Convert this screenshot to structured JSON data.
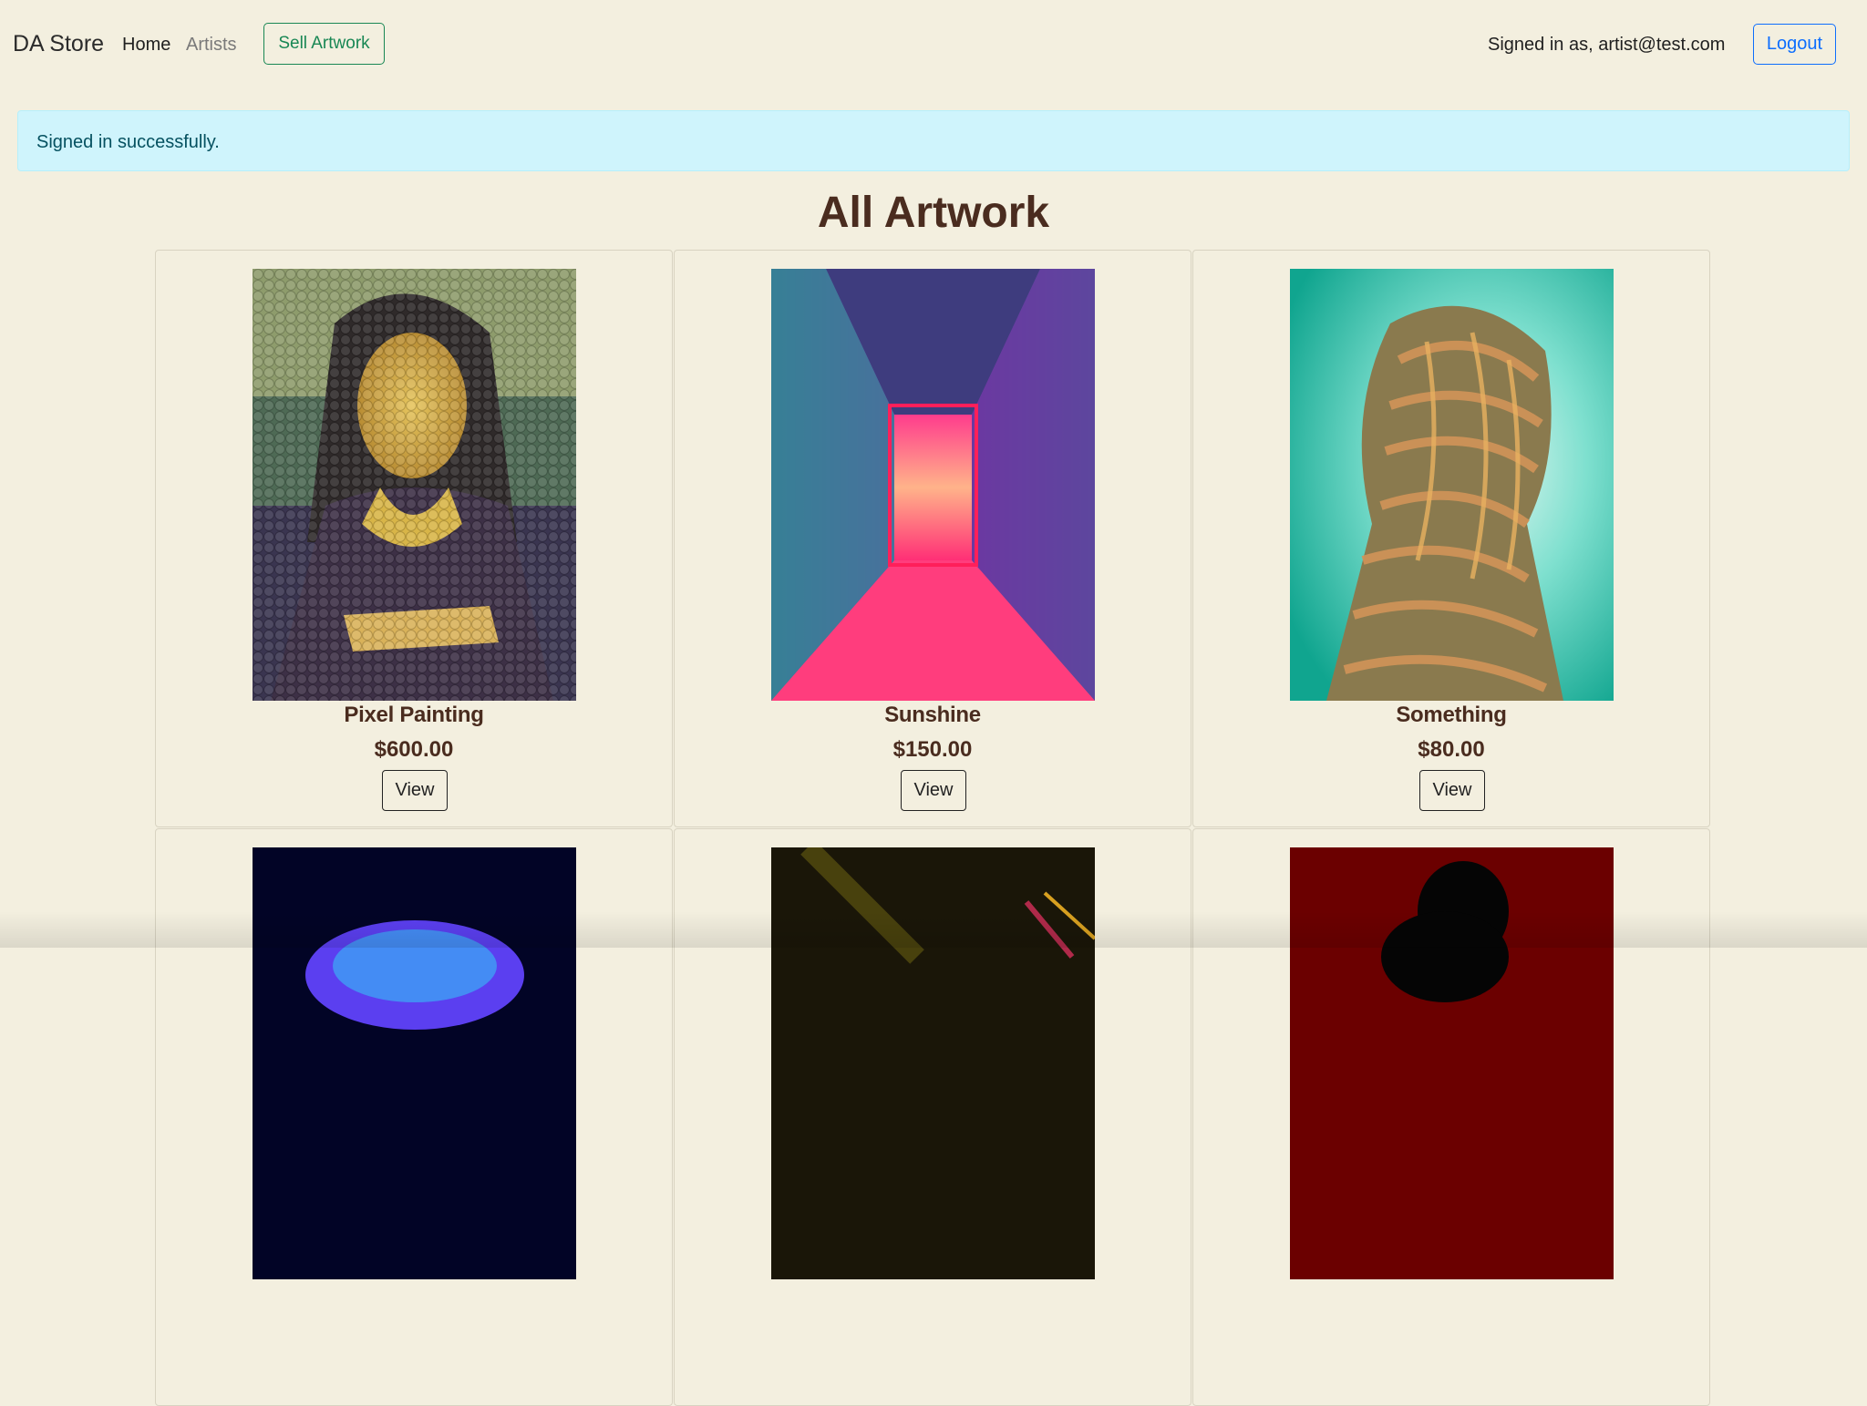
{
  "navbar": {
    "brand": "DA Store",
    "links": [
      "Home",
      "Artists"
    ],
    "sell_label": "Sell Artwork",
    "signed_in_text": "Signed in as, artist@test.com",
    "logout_label": "Logout"
  },
  "alert": {
    "message": "Signed in successfully."
  },
  "page": {
    "title": "All Artwork"
  },
  "artworks": [
    {
      "title": "Pixel Painting",
      "price": "$600.00",
      "view_label": "View",
      "image": "mona-lisa-pixel"
    },
    {
      "title": "Sunshine",
      "price": "$150.00",
      "view_label": "View",
      "image": "neon-corridor"
    },
    {
      "title": "Something",
      "price": "$80.00",
      "view_label": "View",
      "image": "abstract-portrait"
    },
    {
      "image": "blue-sphere-dark"
    },
    {
      "image": "dark-streaks"
    },
    {
      "image": "red-silhouette"
    }
  ],
  "colors": {
    "background": "#f3efdf",
    "accent_green": "#198754",
    "accent_blue": "#0d6efd",
    "alert_bg": "#cff4fc",
    "title_brown": "#4a2c1f"
  }
}
